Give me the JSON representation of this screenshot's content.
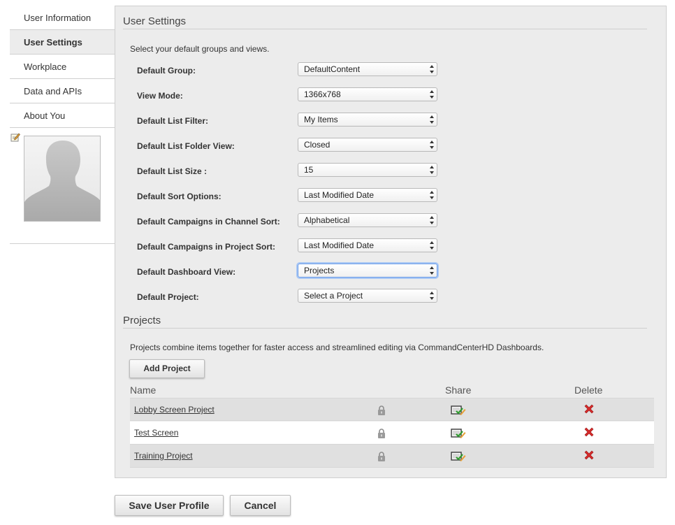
{
  "sidebar": {
    "items": [
      {
        "label": "User Information",
        "active": false
      },
      {
        "label": "User Settings",
        "active": true
      },
      {
        "label": "Workplace",
        "active": false
      },
      {
        "label": "Data and APIs",
        "active": false
      },
      {
        "label": "About You",
        "active": false
      }
    ],
    "edit_icon": "edit-pencil-icon",
    "avatar_icon": "default-user-silhouette-icon"
  },
  "settings": {
    "title": "User Settings",
    "intro": "Select your default groups and views.",
    "rows": [
      {
        "label": "Default Group:",
        "value": "DefaultContent"
      },
      {
        "label": "View Mode:",
        "value": "1366x768"
      },
      {
        "label": "Default List Filter:",
        "value": "My Items"
      },
      {
        "label": "Default List Folder View:",
        "value": "Closed"
      },
      {
        "label": "Default List Size :",
        "value": "15"
      },
      {
        "label": "Default Sort Options:",
        "value": "Last Modified Date"
      },
      {
        "label": "Default Campaigns in Channel Sort:",
        "value": "Alphabetical"
      },
      {
        "label": "Default Campaigns in Project Sort:",
        "value": "Last Modified Date"
      },
      {
        "label": "Default Dashboard View:",
        "value": "Projects",
        "focused": true
      },
      {
        "label": "Default Project:",
        "value": "Select a Project"
      }
    ]
  },
  "projects": {
    "title": "Projects",
    "intro": "Projects combine items together for faster access and streamlined editing via CommandCenterHD Dashboards.",
    "add_label": "Add Project",
    "columns": {
      "name": "Name",
      "share": "Share",
      "delete": "Delete"
    },
    "rows": [
      {
        "name": "Lobby Screen Project"
      },
      {
        "name": "Test Screen"
      },
      {
        "name": "Training Project"
      }
    ],
    "icons": {
      "lock": "lock-icon",
      "share": "share-icon",
      "delete": "delete-x-icon"
    }
  },
  "footer": {
    "save_label": "Save User Profile",
    "cancel_label": "Cancel"
  },
  "colors": {
    "panel_bg": "#ececec",
    "focus_ring": "#a9c7f4",
    "delete_red": "#d42a2a"
  }
}
